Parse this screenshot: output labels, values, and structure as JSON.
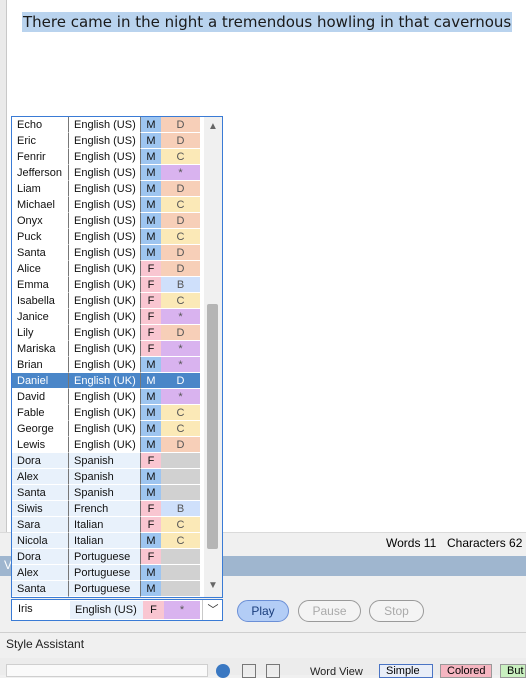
{
  "editor": {
    "text": "There came in the night a tremendous howling in that cavernous"
  },
  "status": {
    "words_label": "Words 11",
    "chars_label": "Characters 62"
  },
  "colors": {
    "gender": {
      "M": "#9ec5f0",
      "F": "#f9c6d1"
    },
    "rating": {
      "D": "#f7cfb8",
      "C": "#fbe9b7",
      "B": "#cfe0fb",
      "*": "#d9b3ef",
      "": "#d1d1d1"
    }
  },
  "voice_list": [
    {
      "name": "Echo",
      "language": "English (US)",
      "gender": "M",
      "rating": "D"
    },
    {
      "name": "Eric",
      "language": "English (US)",
      "gender": "M",
      "rating": "D"
    },
    {
      "name": "Fenrir",
      "language": "English (US)",
      "gender": "M",
      "rating": "C"
    },
    {
      "name": "Jefferson",
      "language": "English (US)",
      "gender": "M",
      "rating": "*"
    },
    {
      "name": "Liam",
      "language": "English (US)",
      "gender": "M",
      "rating": "D"
    },
    {
      "name": "Michael",
      "language": "English (US)",
      "gender": "M",
      "rating": "C"
    },
    {
      "name": "Onyx",
      "language": "English (US)",
      "gender": "M",
      "rating": "D"
    },
    {
      "name": "Puck",
      "language": "English (US)",
      "gender": "M",
      "rating": "C"
    },
    {
      "name": "Santa",
      "language": "English (US)",
      "gender": "M",
      "rating": "D"
    },
    {
      "name": "Alice",
      "language": "English (UK)",
      "gender": "F",
      "rating": "D"
    },
    {
      "name": "Emma",
      "language": "English (UK)",
      "gender": "F",
      "rating": "B"
    },
    {
      "name": "Isabella",
      "language": "English (UK)",
      "gender": "F",
      "rating": "C"
    },
    {
      "name": "Janice",
      "language": "English (UK)",
      "gender": "F",
      "rating": "*"
    },
    {
      "name": "Lily",
      "language": "English (UK)",
      "gender": "F",
      "rating": "D"
    },
    {
      "name": "Mariska",
      "language": "English (UK)",
      "gender": "F",
      "rating": "*"
    },
    {
      "name": "Brian",
      "language": "English (UK)",
      "gender": "M",
      "rating": "*"
    },
    {
      "name": "Daniel",
      "language": "English (UK)",
      "gender": "M",
      "rating": "D",
      "selected": true
    },
    {
      "name": "David",
      "language": "English (UK)",
      "gender": "M",
      "rating": "*"
    },
    {
      "name": "Fable",
      "language": "English (UK)",
      "gender": "M",
      "rating": "C"
    },
    {
      "name": "George",
      "language": "English (UK)",
      "gender": "M",
      "rating": "C"
    },
    {
      "name": "Lewis",
      "language": "English (UK)",
      "gender": "M",
      "rating": "D"
    },
    {
      "name": "Dora",
      "language": "Spanish",
      "gender": "F",
      "rating": ""
    },
    {
      "name": "Alex",
      "language": "Spanish",
      "gender": "M",
      "rating": ""
    },
    {
      "name": "Santa",
      "language": "Spanish",
      "gender": "M",
      "rating": ""
    },
    {
      "name": "Siwis",
      "language": "French",
      "gender": "F",
      "rating": "B"
    },
    {
      "name": "Sara",
      "language": "Italian",
      "gender": "F",
      "rating": "C"
    },
    {
      "name": "Nicola",
      "language": "Italian",
      "gender": "M",
      "rating": "C"
    },
    {
      "name": "Dora",
      "language": "Portuguese",
      "gender": "F",
      "rating": ""
    },
    {
      "name": "Alex",
      "language": "Portuguese",
      "gender": "M",
      "rating": ""
    },
    {
      "name": "Santa",
      "language": "Portuguese",
      "gender": "M",
      "rating": ""
    }
  ],
  "combo": {
    "name": "Iris",
    "language": "English (US)",
    "gender": "F",
    "rating": "*"
  },
  "controls": {
    "panel_letter": "V",
    "play": "Play",
    "pause": "Pause",
    "stop": "Stop"
  },
  "style_assistant": {
    "title": "Style Assistant",
    "word_view": "Word View",
    "simple": "Simple",
    "colored": "Colored",
    "but": "But"
  }
}
